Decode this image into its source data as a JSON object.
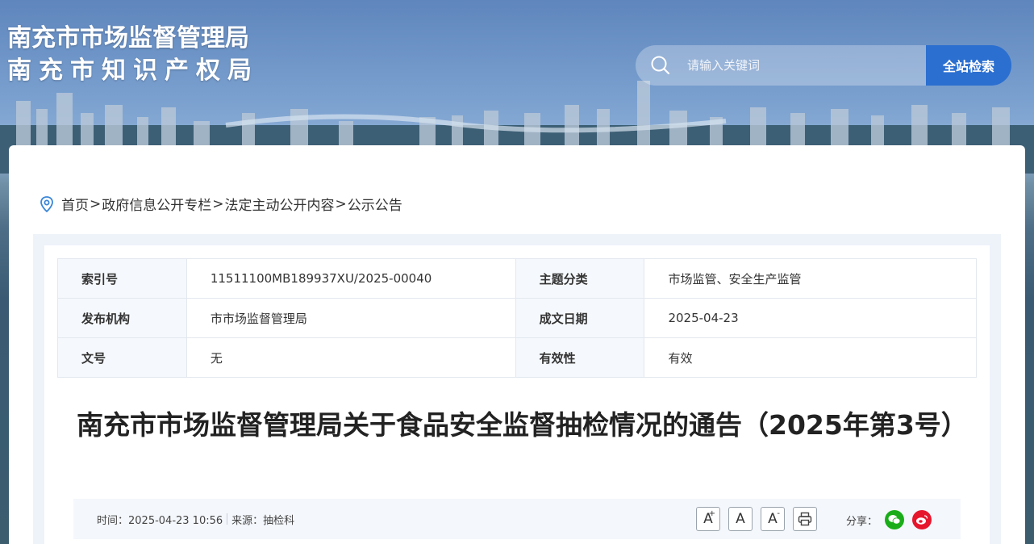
{
  "header": {
    "title_line1": "南充市市场监督管理局",
    "title_line2": "南充市知识产权局",
    "search_placeholder": "请输入关键词",
    "search_button": "全站检索"
  },
  "breadcrumb": {
    "items": [
      "首页",
      "政府信息公开专栏",
      "法定主动公开内容",
      "公示公告"
    ],
    "separator": ">"
  },
  "meta_table": {
    "rows": [
      {
        "k1": "索引号",
        "v1": "11511100MB189937XU/2025-00040",
        "k2": "主题分类",
        "v2": "市场监管、安全生产监管"
      },
      {
        "k1": "发布机构",
        "v1": "市市场监督管理局",
        "k2": "成文日期",
        "v2": "2025-04-23"
      },
      {
        "k1": "文号",
        "v1": "无",
        "k2": "有效性",
        "v2": "有效"
      }
    ]
  },
  "article": {
    "title": "南充市市场监督管理局关于食品安全监督抽检情况的通告（2025年第3号）",
    "time_text": "时间：2025-04-23 10:56",
    "source_text": "来源：抽检科"
  },
  "tools": {
    "font_large": "A",
    "font_normal": "A",
    "font_small": "A",
    "share_label": "分享："
  },
  "colors": {
    "accent": "#2b6fd0",
    "wechat": "#1aad19",
    "weibo": "#e6162d"
  }
}
